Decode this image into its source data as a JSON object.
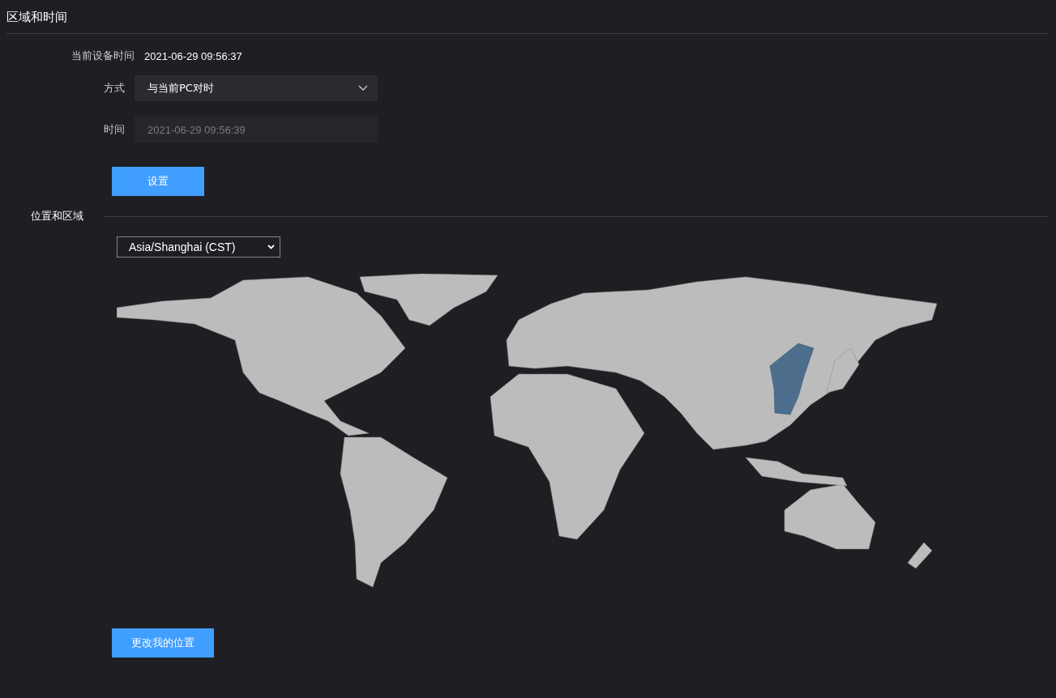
{
  "title": "区域和时间",
  "device_time": {
    "label": "当前设备时间",
    "value": "2021-06-29 09:56:37"
  },
  "mode": {
    "label": "方式",
    "value": "与当前PC对时"
  },
  "time": {
    "label": "时间",
    "value": "2021-06-29 09:56:39",
    "disabled": true
  },
  "set_button": "设置",
  "location": {
    "title": "位置和区域",
    "timezone": "Asia/Shanghai (CST)",
    "change_button": "更改我的位置"
  }
}
